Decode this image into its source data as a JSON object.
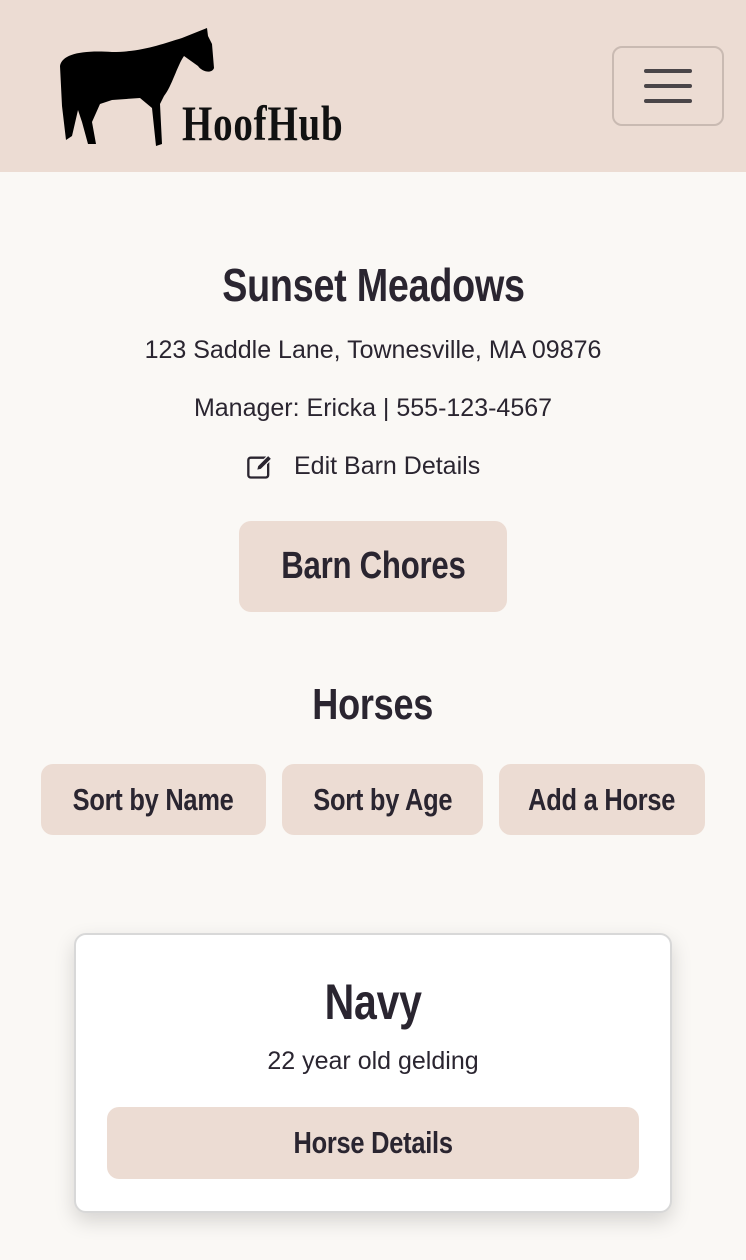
{
  "header": {
    "logo_text": "HoofHub",
    "menu_icon": "hamburger-icon"
  },
  "barn": {
    "name": "Sunset Meadows",
    "address": "123 Saddle Lane, Townesville, MA 09876",
    "manager": "Manager: Ericka | 555-123-4567",
    "edit_label": "Edit Barn Details",
    "chores_label": "Barn Chores"
  },
  "horses": {
    "title": "Horses",
    "sort_name": "Sort by Name",
    "sort_age": "Sort by Age",
    "add": "Add a Horse",
    "items": [
      {
        "name": "Navy",
        "description": "22 year old gelding",
        "details_label": "Horse Details"
      }
    ]
  }
}
